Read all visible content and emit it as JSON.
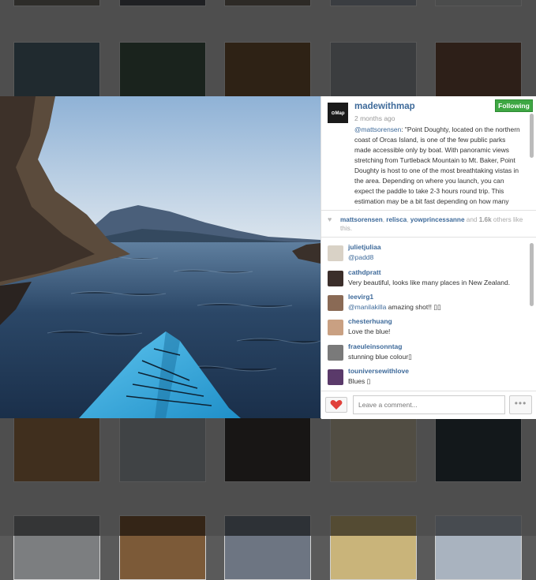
{
  "post": {
    "username": "madewithmap",
    "time": "2 months ago",
    "follow_label": "Following",
    "avatar_text": "⊙Map",
    "caption_mention": "@mattsorensen",
    "caption_text": ": \"Point Doughty, located on the northern coast of Orcas Island, is one of the few public parks made accessible only by boat. With panoramic views stretching from Turtleback Mountain to Mt. Baker, Point Doughty is host to one of the most breathtaking vistas in the area. Depending on where you launch, you can expect the paddle to take 2-3 hours round trip. This estimation may be a bit fast depending on how many stops you"
  },
  "likes": {
    "users": [
      "mattsorensen",
      "relisca",
      "yowprincessanne"
    ],
    "separator": ", ",
    "and": " and ",
    "count": "1.6k",
    "suffix": " others like this."
  },
  "comments": [
    {
      "user": "julietjuliaa",
      "mention": "@padd8",
      "text": "",
      "avatar_color": "#d9d2c6"
    },
    {
      "user": "cathdpratt",
      "mention": "",
      "text": "Very beautiful, looks like many places in New Zealand.",
      "avatar_color": "#3b2e2a"
    },
    {
      "user": "leevirg1",
      "mention": "@manilakilla",
      "text": " amazing shot!! ▯▯",
      "avatar_color": "#8a6a55"
    },
    {
      "user": "chesterhuang",
      "mention": "",
      "text": "Love the blue!",
      "avatar_color": "#c9a082"
    },
    {
      "user": "fraeuleinsonntag",
      "mention": "",
      "text": "stunning blue colour▯",
      "avatar_color": "#7a7a7a"
    },
    {
      "user": "touniversewithlove",
      "mention": "",
      "text": "Blues ▯",
      "avatar_color": "#5a3a6a"
    }
  ],
  "footer": {
    "comment_placeholder": "Leave a comment...",
    "more_label": "•••"
  },
  "background_thumbs": [
    {
      "label": "",
      "color": "#6d6a63"
    },
    {
      "label": "",
      "color": "#4a4e54"
    },
    {
      "label": "",
      "color": "#6b645b"
    },
    {
      "label": "",
      "color": "#8a929b"
    },
    {
      "label": "",
      "color": "#b3b5b6"
    },
    {
      "label": "",
      "color": "#4d6470"
    },
    {
      "label": "",
      "color": "#3f5547"
    },
    {
      "label": "",
      "color": "#6e5234"
    },
    {
      "label": "",
      "color": "#8e9197"
    },
    {
      "label": "",
      "color": "#6b4a3a"
    },
    {
      "label": "",
      "color": "#9a7048"
    },
    {
      "label": "",
      "color": "#9aa0a4"
    },
    {
      "label": "",
      "color": "#3a3634"
    },
    {
      "label": "",
      "color": "#c2b79f"
    },
    {
      "label": "",
      "color": "#2e3b42"
    },
    {
      "label": "",
      "color": "#7c7e80"
    },
    {
      "label": "",
      "color": "#7c5a38"
    },
    {
      "label": "",
      "color": "#6d7582"
    },
    {
      "label": "",
      "color": "#c9b47a"
    },
    {
      "label": "",
      "color": "#a9b3bf"
    }
  ]
}
